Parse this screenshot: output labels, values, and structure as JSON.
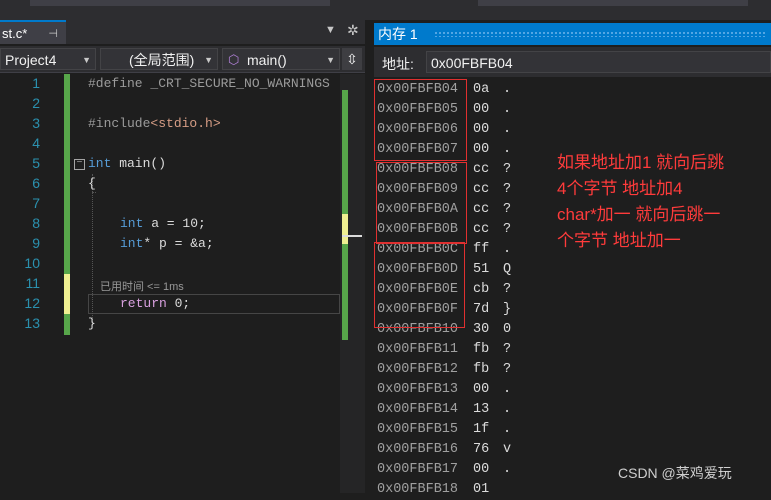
{
  "editor": {
    "tab_title": "st.c*",
    "tab_pin": "⊣",
    "nav": {
      "project": "Project4",
      "scope": "(全局范围)",
      "function": "main()"
    },
    "line_numbers": [
      "1",
      "2",
      "3",
      "4",
      "5",
      "6",
      "7",
      "8",
      "9",
      "10",
      "11",
      "12",
      "13"
    ],
    "code": {
      "l1": "#define _CRT_SECURE_NO_WARNINGS",
      "l3a": "#include",
      "l3b": "<stdio.h>",
      "l5kw": "int",
      "l5": " main()",
      "l6": "{",
      "l8kw": "int",
      "l8": " a = 10;",
      "l9kw": "int",
      "l9": "* p = &a;",
      "l12kw": "return",
      "l12": " 0;",
      "l13": "}"
    },
    "perf_tip": "已用时间 <= 1ms"
  },
  "memory": {
    "title": "内存 1",
    "address_label": "地址:",
    "address_value": "0x00FBFB04",
    "rows": [
      {
        "addr": "0x00FBFB04",
        "hex": "0a",
        "chr": "."
      },
      {
        "addr": "0x00FBFB05",
        "hex": "00",
        "chr": "."
      },
      {
        "addr": "0x00FBFB06",
        "hex": "00",
        "chr": "."
      },
      {
        "addr": "0x00FBFB07",
        "hex": "00",
        "chr": "."
      },
      {
        "addr": "0x00FBFB08",
        "hex": "cc",
        "chr": "?"
      },
      {
        "addr": "0x00FBFB09",
        "hex": "cc",
        "chr": "?"
      },
      {
        "addr": "0x00FBFB0A",
        "hex": "cc",
        "chr": "?"
      },
      {
        "addr": "0x00FBFB0B",
        "hex": "cc",
        "chr": "?"
      },
      {
        "addr": "0x00FBFB0C",
        "hex": "ff",
        "chr": "."
      },
      {
        "addr": "0x00FBFB0D",
        "hex": "51",
        "chr": "Q"
      },
      {
        "addr": "0x00FBFB0E",
        "hex": "cb",
        "chr": "?"
      },
      {
        "addr": "0x00FBFB0F",
        "hex": "7d",
        "chr": "}"
      },
      {
        "addr": "0x00FBFB10",
        "hex": "30",
        "chr": "0"
      },
      {
        "addr": "0x00FBFB11",
        "hex": "fb",
        "chr": "?"
      },
      {
        "addr": "0x00FBFB12",
        "hex": "fb",
        "chr": "?"
      },
      {
        "addr": "0x00FBFB13",
        "hex": "00",
        "chr": "."
      },
      {
        "addr": "0x00FBFB14",
        "hex": "13",
        "chr": "."
      },
      {
        "addr": "0x00FBFB15",
        "hex": "1f",
        "chr": "."
      },
      {
        "addr": "0x00FBFB16",
        "hex": "76",
        "chr": "v"
      },
      {
        "addr": "0x00FBFB17",
        "hex": "00",
        "chr": "."
      },
      {
        "addr": "0x00FBFB18",
        "hex": "01",
        "chr": ""
      }
    ],
    "annotation": [
      "如果地址加1 就向后跳",
      "4个字节 地址加4",
      "char*加一 就向后跳一",
      "个字节 地址加一"
    ],
    "watermark": "CSDN @菜鸡爱玩"
  }
}
